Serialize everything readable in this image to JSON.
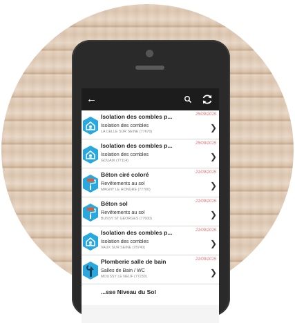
{
  "toolbar": {
    "back_icon": "arrow-left-icon",
    "search_icon": "search-icon",
    "refresh_icon": "refresh-icon"
  },
  "colors": {
    "accent": "#29a7df",
    "date": "#e56a6a",
    "appbar": "#1c1c1c"
  },
  "items": [
    {
      "title": "Isolation des combles p...",
      "subtitle": "Isolation des combles",
      "location": "LA CELLE SUR SEINE (77670)",
      "date": "25/09/2015",
      "icon": "house-insulation-icon"
    },
    {
      "title": "Isolation des combles p...",
      "subtitle": "Isolation des combles",
      "location": "GOUAIX (77114)",
      "date": "25/09/2015",
      "icon": "house-insulation-icon"
    },
    {
      "title": "Béton ciré coloré",
      "subtitle": "Revêtements au sol",
      "location": "MAGNY LE HONGRE (77700)",
      "date": "21/09/2015",
      "icon": "paint-roller-icon"
    },
    {
      "title": "Béton sol",
      "subtitle": "Revêtements au sol",
      "location": "BUSSY ST GEORGES (77600)",
      "date": "21/09/2015",
      "icon": "paint-roller-icon"
    },
    {
      "title": "Isolation des combles p...",
      "subtitle": "Isolation des combles",
      "location": "VAUX SUR SEINE (78740)",
      "date": "21/09/2015",
      "icon": "house-insulation-icon"
    },
    {
      "title": "Plomberie salle de bain",
      "subtitle": "Salles de Bain / WC",
      "location": "MOUSSY LE NEUF (77230)",
      "date": "21/09/2015",
      "icon": "wrench-icon"
    }
  ],
  "partial_item": {
    "title": "...sse Niveau du Sol"
  }
}
